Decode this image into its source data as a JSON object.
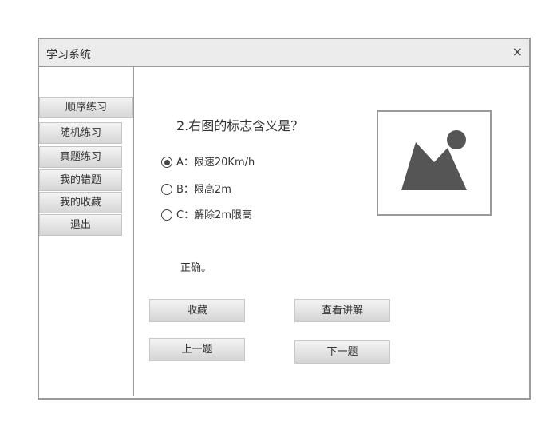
{
  "window": {
    "title": "学习系统",
    "close_label": "×"
  },
  "sidebar": {
    "items": [
      {
        "label": "顺序练习"
      },
      {
        "label": "随机练习"
      },
      {
        "label": "真题练习"
      },
      {
        "label": "我的错题"
      },
      {
        "label": "我的收藏"
      },
      {
        "label": "退出"
      }
    ]
  },
  "question": {
    "text": "2.右图的标志含义是？",
    "options": [
      {
        "label": "A：限速20Km/h",
        "selected": true
      },
      {
        "label": "B：限高2m",
        "selected": false
      },
      {
        "label": "C：解除2m限高",
        "selected": false
      }
    ],
    "result": "正确。"
  },
  "actions": {
    "favorite": "收藏",
    "explain": "查看讲解",
    "prev": "上一题",
    "next": "下一题"
  },
  "image": {
    "icon": "image-placeholder-icon"
  },
  "colors": {
    "border": "#9a9a9a",
    "button_top": "#f4f4f4",
    "button_bottom": "#d4d4d4",
    "icon": "#555555"
  }
}
